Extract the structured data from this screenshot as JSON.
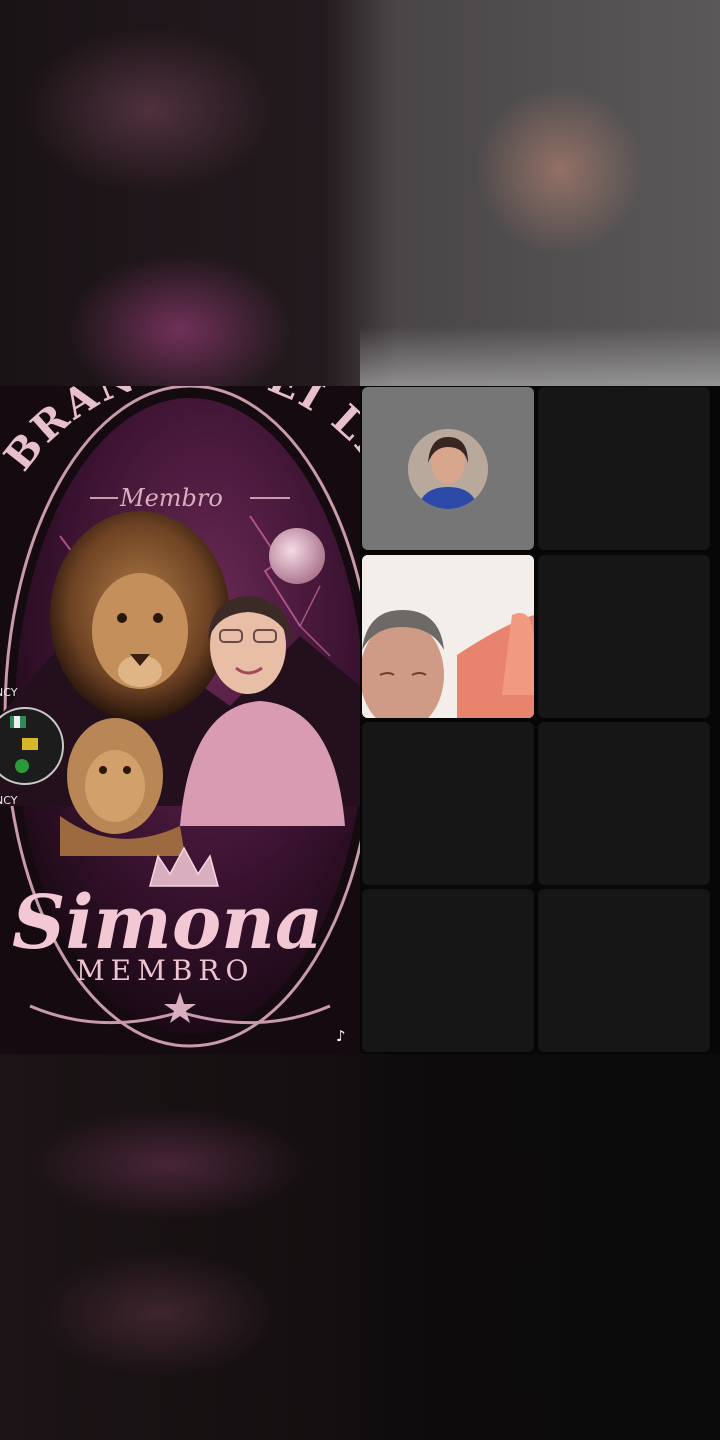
{
  "poster": {
    "arc_title": "BRANCO DEI LE",
    "subtitle_script": "Membro",
    "badge_top": "NCY",
    "badge_bottom": "NCY",
    "member_name": "Simona",
    "member_role": "MEMBRO"
  },
  "watermark": {
    "icon": "tiktok-logo-icon"
  },
  "guests": [
    {
      "slot": 1,
      "state": "audio-avatar",
      "icon": "guest-avatar"
    },
    {
      "slot": 2,
      "state": "empty"
    },
    {
      "slot": 3,
      "state": "video",
      "icon": "guest-video-feed"
    },
    {
      "slot": 4,
      "state": "empty"
    },
    {
      "slot": 5,
      "state": "empty"
    },
    {
      "slot": 6,
      "state": "empty"
    },
    {
      "slot": 7,
      "state": "empty"
    },
    {
      "slot": 8,
      "state": "empty"
    }
  ],
  "colors": {
    "poster_pink": "#e8c0cc",
    "slot_empty": "#161616",
    "slot_audio": "#767676"
  }
}
